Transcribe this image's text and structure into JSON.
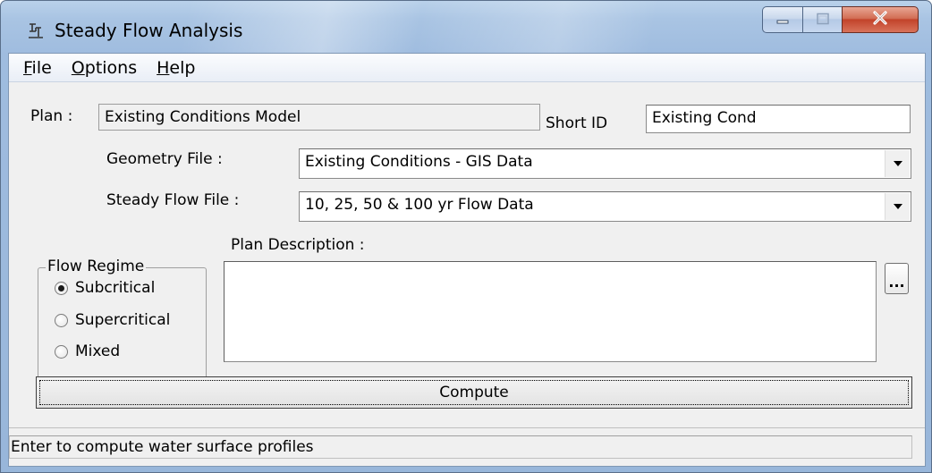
{
  "window": {
    "title": "Steady Flow Analysis",
    "icon": "hec-ras-app-icon"
  },
  "caption_buttons": {
    "minimize_icon": "minimize-icon",
    "maximize_icon": "maximize-icon",
    "close_icon": "close-icon",
    "close_color": "#c9432a"
  },
  "menu": {
    "items": [
      {
        "label_pre": "",
        "label_u": "F",
        "label_post": "ile"
      },
      {
        "label_pre": "",
        "label_u": "O",
        "label_post": "ptions"
      },
      {
        "label_pre": "",
        "label_u": "H",
        "label_post": "elp"
      }
    ]
  },
  "plan": {
    "label": "Plan :",
    "value": "Existing Conditions Model",
    "short_id_label": "Short ID",
    "short_id_value": "Existing Cond"
  },
  "geometry": {
    "label": "Geometry File :",
    "value": "Existing Conditions - GIS Data"
  },
  "steady_flow": {
    "label": "Steady Flow File :",
    "value": "10, 25, 50 & 100 yr Flow Data"
  },
  "flow_regime": {
    "legend": "Flow Regime",
    "options": [
      "Subcritical",
      "Supercritical",
      "Mixed"
    ],
    "selected": "Subcritical"
  },
  "description": {
    "label": "Plan Description :",
    "value": "",
    "browse_label": "..."
  },
  "compute": {
    "label": "Compute"
  },
  "status": {
    "text": "Enter to compute water surface profiles"
  }
}
